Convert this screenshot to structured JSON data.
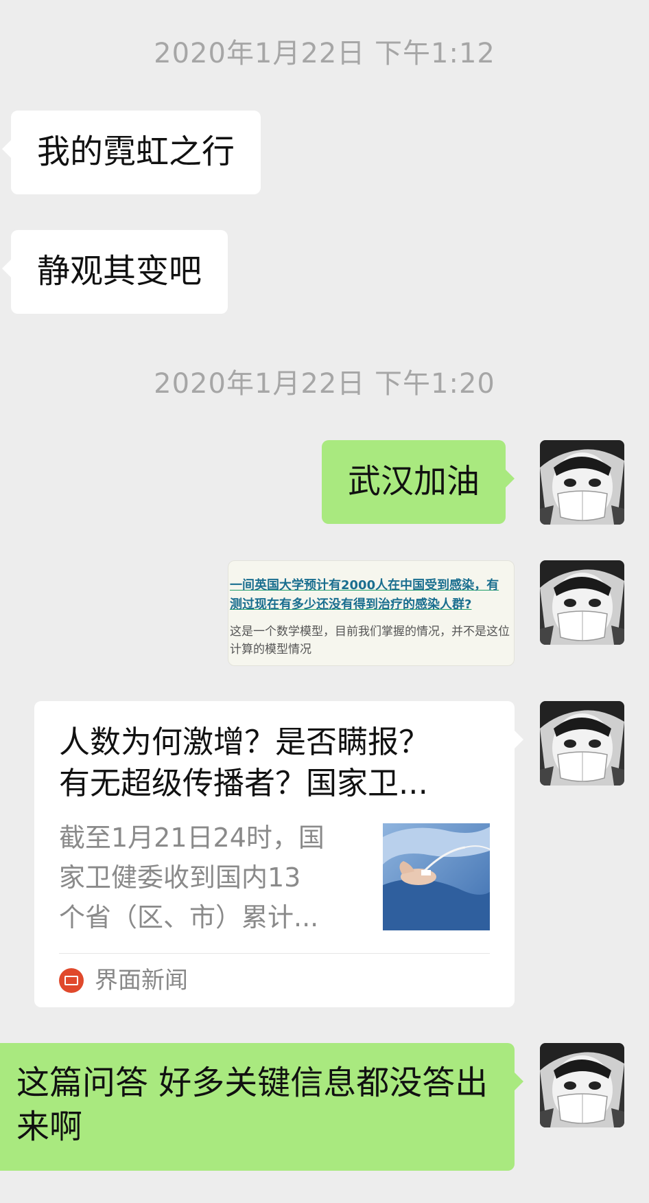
{
  "timestamps": {
    "first": "2020年1月22日 下午1:12",
    "second": "2020年1月22日 下午1:20"
  },
  "messages": {
    "incoming_1": "我的霓虹之行",
    "incoming_2": "静观其变吧",
    "outgoing_1": "武汉加油",
    "outgoing_last": "这篇问答 好多关键信息都没答出来啊"
  },
  "image_message": {
    "line_1": "一间英国大学预计有2000人在中国受到感染，有",
    "line_2": "测过现在有多少还没有得到治疗的感染人群?",
    "line_3": "这是一个数学模型，目前我们掌握的情况，并不是这位",
    "line_4": "计算的模型情况"
  },
  "article_card": {
    "title_line_1": "人数为何激增？是否瞒报？",
    "title_line_2": "有无超级传播者？国家卫...",
    "desc_line_1": "截至1月21日24时，国",
    "desc_line_2": "家卫健委收到国内13",
    "desc_line_3": "个省（区、市）累计...",
    "source": "界面新闻"
  },
  "colors": {
    "background": "#ededed",
    "incoming_bubble": "#ffffff",
    "outgoing_bubble": "#a9e97f",
    "timestamp": "#a6a6a6",
    "source_logo": "#e0492c"
  },
  "icons": {
    "avatar": "manga-girl-with-mask-avatar",
    "source_logo": "jiemian-news-logo"
  }
}
